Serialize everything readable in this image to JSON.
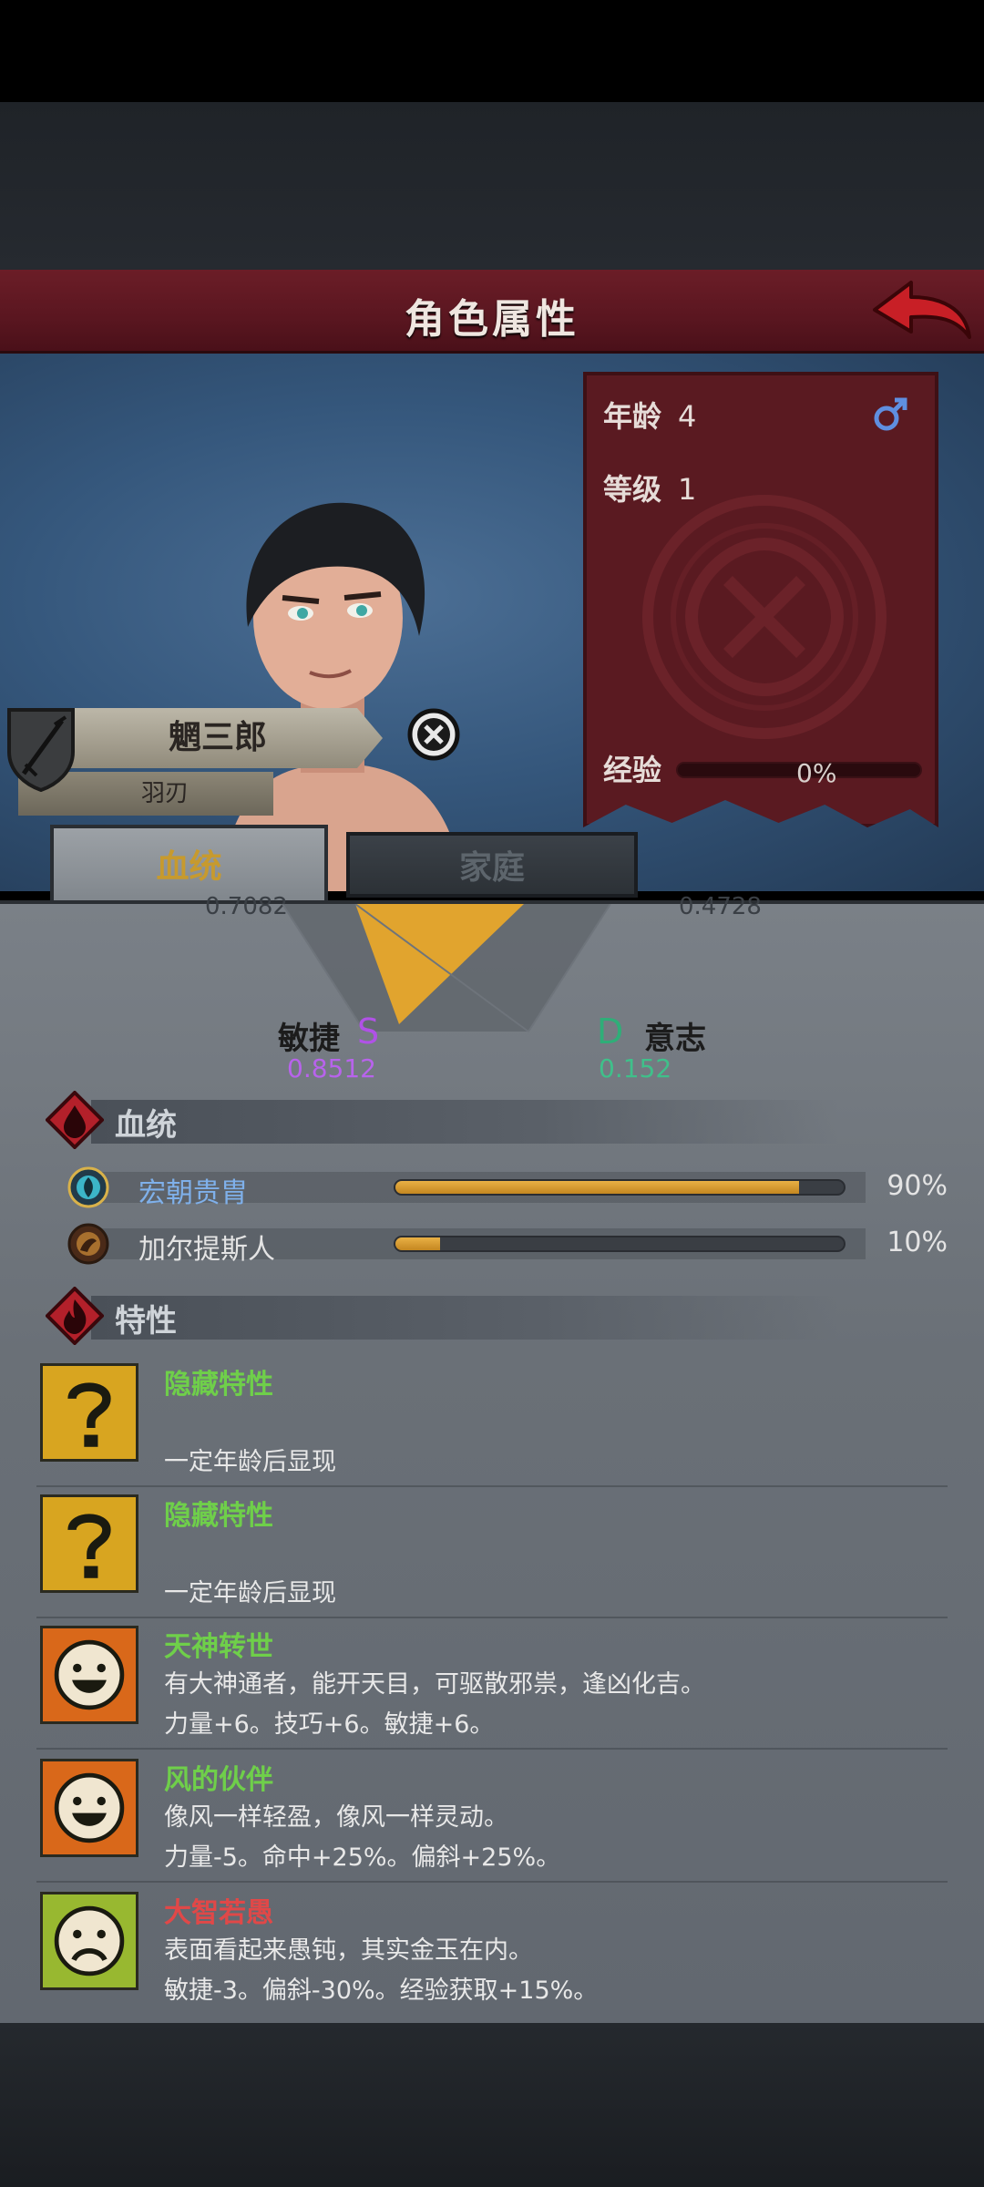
{
  "header": {
    "title": "角色属性"
  },
  "character": {
    "name": "魍三郎",
    "subtitle": "羽刃"
  },
  "stats": {
    "age_label": "年龄",
    "age_value": "4",
    "level_label": "等级",
    "level_value": "1",
    "exp_label": "经验",
    "exp_value": "0%",
    "exp_fraction": 0
  },
  "tabs": [
    {
      "label": "血统",
      "active": true
    },
    {
      "label": "家庭",
      "active": false
    }
  ],
  "radar": {
    "cut_left_value": "0.7082",
    "cut_right_value": "0.4728",
    "agility_label": "敏捷",
    "agility_grade": "S",
    "agility_value": "0.8512",
    "will_label": "意志",
    "will_grade": "D",
    "will_value": "0.152"
  },
  "bloodline_section": {
    "title": "血统"
  },
  "bloodlines": [
    {
      "name": "宏朝贵胄",
      "percent_text": "90%",
      "fraction": 0.9,
      "color": "#7fb0ea"
    },
    {
      "name": "加尔提斯人",
      "percent_text": "10%",
      "fraction": 0.1,
      "color": "#e4e4e4"
    }
  ],
  "traits_section": {
    "title": "特性"
  },
  "traits": [
    {
      "name": "隐藏特性",
      "desc": "",
      "effect": "一定年龄后显现",
      "icon": "question-icon",
      "name_color": "#6fcf4a"
    },
    {
      "name": "隐藏特性",
      "desc": "",
      "effect": "一定年龄后显现",
      "icon": "question-icon",
      "name_color": "#6fcf4a"
    },
    {
      "name": "天神转世",
      "desc": "有大神通者，能开天目，可驱散邪祟，逢凶化吉。",
      "effect": "力量+6。技巧+6。敏捷+6。",
      "icon": "happy-face-icon",
      "name_color": "#6fcf4a"
    },
    {
      "name": "风的伙伴",
      "desc": "像风一样轻盈，像风一样灵动。",
      "effect": "力量-5。命中+25%。偏斜+25%。",
      "icon": "happy-face-icon",
      "name_color": "#6fcf4a"
    },
    {
      "name": "大智若愚",
      "desc": "表面看起来愚钝，其实金玉在内。",
      "effect": "敏捷-3。偏斜-30%。经验获取+15%。",
      "icon": "sad-face-icon",
      "name_color": "#e04848"
    }
  ]
}
